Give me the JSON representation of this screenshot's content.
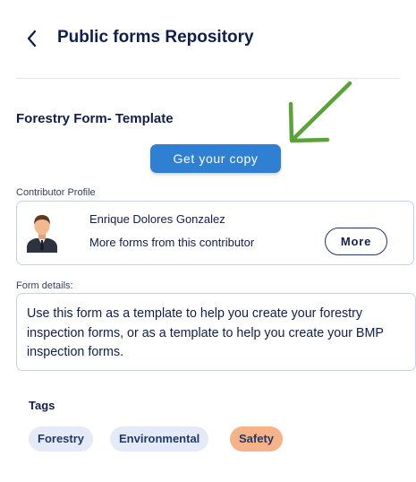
{
  "header": {
    "title": "Public forms Repository",
    "back_icon": "chevron-left-icon"
  },
  "form": {
    "title": "Forestry Form- Template"
  },
  "actions": {
    "copy_label": "Get your copy"
  },
  "annotation": {
    "icon": "arrow-down-left-icon",
    "color": "#5aa336"
  },
  "contributor": {
    "section_label": "Contributor Profile",
    "name": "Enrique Dolores Gonzalez",
    "more_text": "More forms from this contributor",
    "more_button": "More",
    "avatar_icon": "user-avatar-icon"
  },
  "details": {
    "section_label": "Form details:",
    "text": "Use this form as a template to help you create your forestry inspection forms, or as a template to help you create your BMP inspection forms."
  },
  "tags": {
    "label": "Tags",
    "items": [
      {
        "label": "Forestry",
        "color": "#e5eaf8"
      },
      {
        "label": "Environmental",
        "color": "#e5eaf8"
      },
      {
        "label": "Safety",
        "color": "#f6b389"
      }
    ]
  },
  "colors": {
    "primary": "#2f7fd3",
    "text": "#0f1f4d",
    "border": "#c5d2e8"
  }
}
